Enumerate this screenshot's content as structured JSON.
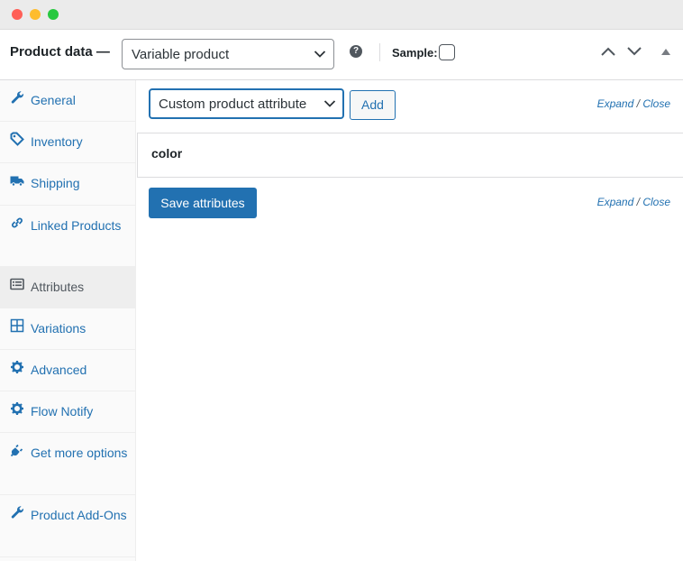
{
  "header": {
    "title": "Product data —",
    "product_type": "Variable product",
    "help_icon": "question-circle-icon",
    "sample_label": "Sample:"
  },
  "sidebar": {
    "items": [
      {
        "label": "General",
        "icon": "wrench-icon",
        "active": false
      },
      {
        "label": "Inventory",
        "icon": "tag-icon",
        "active": false
      },
      {
        "label": "Shipping",
        "icon": "truck-icon",
        "active": false
      },
      {
        "label": "Linked Products",
        "icon": "link-icon",
        "active": false
      },
      {
        "label": "Attributes",
        "icon": "list-icon",
        "active": true
      },
      {
        "label": "Variations",
        "icon": "grid-icon",
        "active": false
      },
      {
        "label": "Advanced",
        "icon": "gear-icon",
        "active": false
      },
      {
        "label": "Flow Notify",
        "icon": "gear-icon",
        "active": false
      },
      {
        "label": "Get more options",
        "icon": "plug-icon",
        "active": false
      },
      {
        "label": "Product Add-Ons",
        "icon": "wrench-icon",
        "active": false
      }
    ]
  },
  "main": {
    "attribute_select": "Custom product attribute",
    "add_label": "Add",
    "expand_label": "Expand",
    "slash": "/",
    "close_label": "Close",
    "attributes": [
      {
        "name": "color"
      }
    ],
    "save_label": "Save attributes"
  },
  "colors": {
    "accent": "#2271b1",
    "active_tab_bg": "#eeeeee",
    "sidebar_bg": "#fafafa"
  }
}
